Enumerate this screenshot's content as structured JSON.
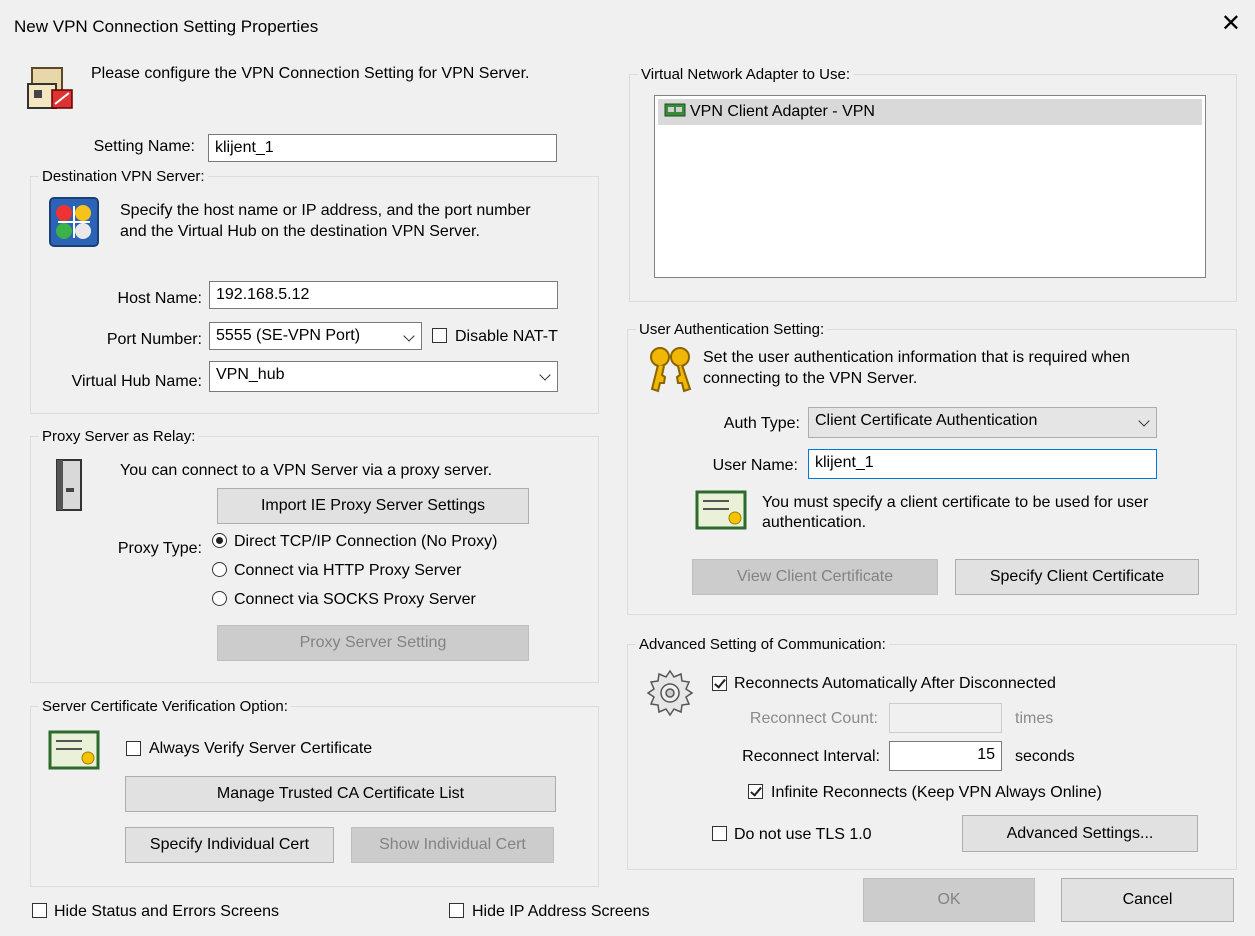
{
  "window": {
    "title": "New VPN Connection Setting Properties",
    "close_glyph": "✕"
  },
  "intro": {
    "text": "Please configure the VPN Connection Setting for VPN Server."
  },
  "setting_name": {
    "label": "Setting Name:",
    "value": "klijent_1"
  },
  "destination": {
    "legend": "Destination VPN Server:",
    "desc_line1": "Specify the host name or IP address, and the port number",
    "desc_line2": "and the Virtual Hub on the destination VPN Server.",
    "host_label": "Host Name:",
    "host_value": "192.168.5.12",
    "port_label": "Port Number:",
    "port_value": "5555 (SE-VPN Port)",
    "disable_natt_label": "Disable NAT-T",
    "disable_natt_checked": false,
    "hub_label": "Virtual Hub Name:",
    "hub_value": "VPN_hub"
  },
  "proxy": {
    "legend": "Proxy Server as Relay:",
    "desc": "You can connect to a VPN Server via a proxy server.",
    "import_button": "Import IE Proxy Server Settings",
    "type_label": "Proxy Type:",
    "options": [
      "Direct TCP/IP Connection (No Proxy)",
      "Connect via HTTP Proxy Server",
      "Connect via SOCKS Proxy Server"
    ],
    "selected_index": 0,
    "setting_button": "Proxy Server Setting"
  },
  "server_cert": {
    "legend": "Server Certificate Verification Option:",
    "always_verify_label": "Always Verify Server Certificate",
    "always_verify_checked": false,
    "manage_button": "Manage Trusted CA Certificate List",
    "specify_button": "Specify Individual Cert",
    "show_button": "Show Individual Cert"
  },
  "adapter": {
    "legend": "Virtual Network Adapter to Use:",
    "items": [
      "VPN Client Adapter - VPN"
    ]
  },
  "user_auth": {
    "legend": "User Authentication Setting:",
    "desc_line1": "Set the user authentication information that is required when",
    "desc_line2": "connecting to the VPN Server.",
    "auth_type_label": "Auth Type:",
    "auth_type_value": "Client Certificate Authentication",
    "user_name_label": "User Name:",
    "user_name_value": "klijent_1",
    "cert_note_line1": "You must specify a client certificate to be used for user",
    "cert_note_line2": "authentication.",
    "view_button": "View Client Certificate",
    "specify_button": "Specify Client Certificate"
  },
  "advanced": {
    "legend": "Advanced Setting of Communication:",
    "reconnect_label": "Reconnects Automatically After Disconnected",
    "reconnect_checked": true,
    "count_label": "Reconnect Count:",
    "count_value": "",
    "count_unit": "times",
    "interval_label": "Reconnect Interval:",
    "interval_value": "15",
    "interval_unit": "seconds",
    "infinite_label": "Infinite Reconnects (Keep VPN Always Online)",
    "infinite_checked": true,
    "no_tls_label": "Do not use TLS 1.0",
    "no_tls_checked": false,
    "advanced_button": "Advanced Settings..."
  },
  "footer": {
    "hide_status_label": "Hide Status and Errors Screens",
    "hide_status_checked": false,
    "hide_ip_label": "Hide IP Address Screens",
    "hide_ip_checked": false,
    "ok_button": "OK",
    "cancel_button": "Cancel"
  }
}
